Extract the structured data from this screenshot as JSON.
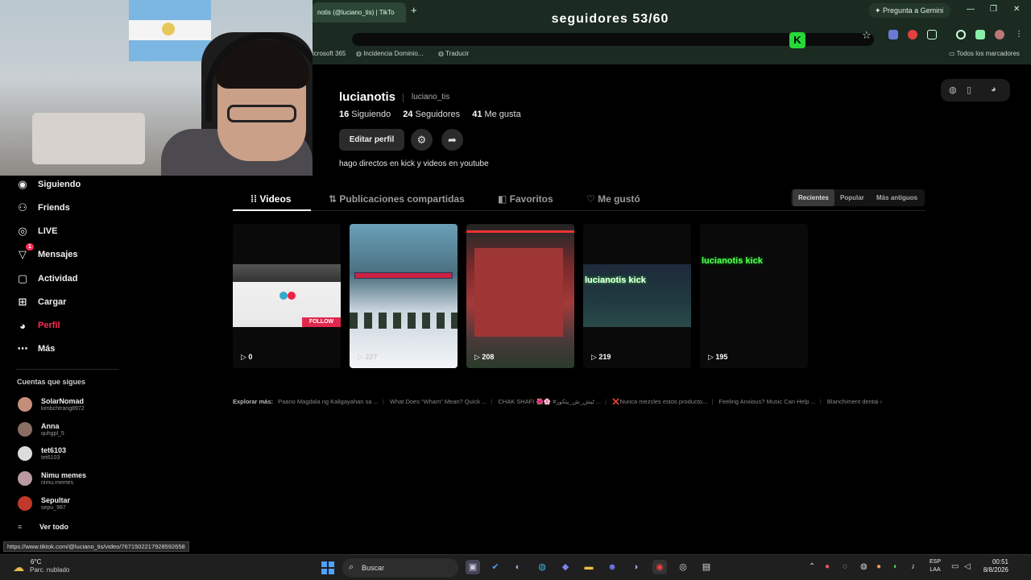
{
  "overlay": {
    "followers_goal": "seguidores 53/60",
    "kick_logo": "K"
  },
  "browser": {
    "tab_title": "notis (@luciano_tis) | TikTo",
    "new_tab": "+",
    "gemini": "Pregunta a Gemini",
    "bookmarks": [
      "icrosoft 365",
      "Incidencia Dominio...",
      "Traducir"
    ],
    "all_bookmarks": "Todos los marcadores",
    "status_url": "https://www.tiktok.com/@luciano_tis/video/7671502217928592658"
  },
  "sidebar": {
    "items": [
      {
        "label": "Siguiendo",
        "icon": "following-icon"
      },
      {
        "label": "Friends",
        "icon": "friends-icon"
      },
      {
        "label": "LIVE",
        "icon": "live-icon"
      },
      {
        "label": "Mensajes",
        "icon": "messages-icon",
        "badge": "1"
      },
      {
        "label": "Actividad",
        "icon": "activity-icon"
      },
      {
        "label": "Cargar",
        "icon": "upload-icon"
      },
      {
        "label": "Perfil",
        "icon": "profile-icon"
      },
      {
        "label": "Más",
        "icon": "more-icon"
      }
    ],
    "following_header": "Cuentas que sigues",
    "accounts": [
      {
        "name": "SolarNomad",
        "handle": "kimbchtrang8972",
        "color": "#c58e7a"
      },
      {
        "name": "Anna",
        "handle": "quhgpl_5",
        "color": "#8a6d63"
      },
      {
        "name": "tet6103",
        "handle": "tet6103",
        "color": "#dcdcdc"
      },
      {
        "name": "Nimu memes",
        "handle": "nimu.memes",
        "color": "#b89aa0"
      },
      {
        "name": "Sepultar",
        "handle": "sepu_987",
        "color": "#c0392b"
      }
    ],
    "see_all": "Ver todo"
  },
  "profile": {
    "username": "lucianotis",
    "handle": "luciano_tis",
    "following_count": "16",
    "following_label": "Siguiendo",
    "followers_count": "24",
    "followers_label": "Seguidores",
    "likes_count": "41",
    "likes_label": "Me gusta",
    "edit_button": "Editar perfil",
    "bio": "hago directos en kick y videos en youtube"
  },
  "tabs": [
    "Videos",
    "Publicaciones compartidas",
    "Favoritos",
    "Me gustó"
  ],
  "sort": [
    "Recientes",
    "Popular",
    "Más antiguos"
  ],
  "videos": [
    {
      "views": "0",
      "overlay": "FOLLOW"
    },
    {
      "views": "227",
      "overlay": ""
    },
    {
      "views": "208",
      "overlay": ""
    },
    {
      "views": "219",
      "overlay": "lucianotis kick"
    },
    {
      "views": "195",
      "overlay": "lucianotis kick"
    }
  ],
  "explore": {
    "label": "Explorar más:",
    "items": [
      "Paano Magdala ng Kaligayahan sa ...",
      "What Does “Wham” Mean? Quick ...",
      "CHAK SHAFI 🌺🌸 #ٹیش_ش_یتکور ...",
      "❌Nunca mezcles estos producto...",
      "Feeling Anxious? Music Can Help ...",
      "Blanchiment dentai"
    ]
  },
  "taskbar": {
    "temperature": "6°C",
    "weather": "Parc. nublado",
    "search": "Buscar",
    "lang_top": "ESP",
    "lang_bottom": "LAA",
    "time": "00:51",
    "date": "8/8/2026"
  },
  "colors": {
    "accent": "#fe2c55",
    "kick_green": "#26d93a",
    "chrome_bg": "#1b2b21"
  }
}
